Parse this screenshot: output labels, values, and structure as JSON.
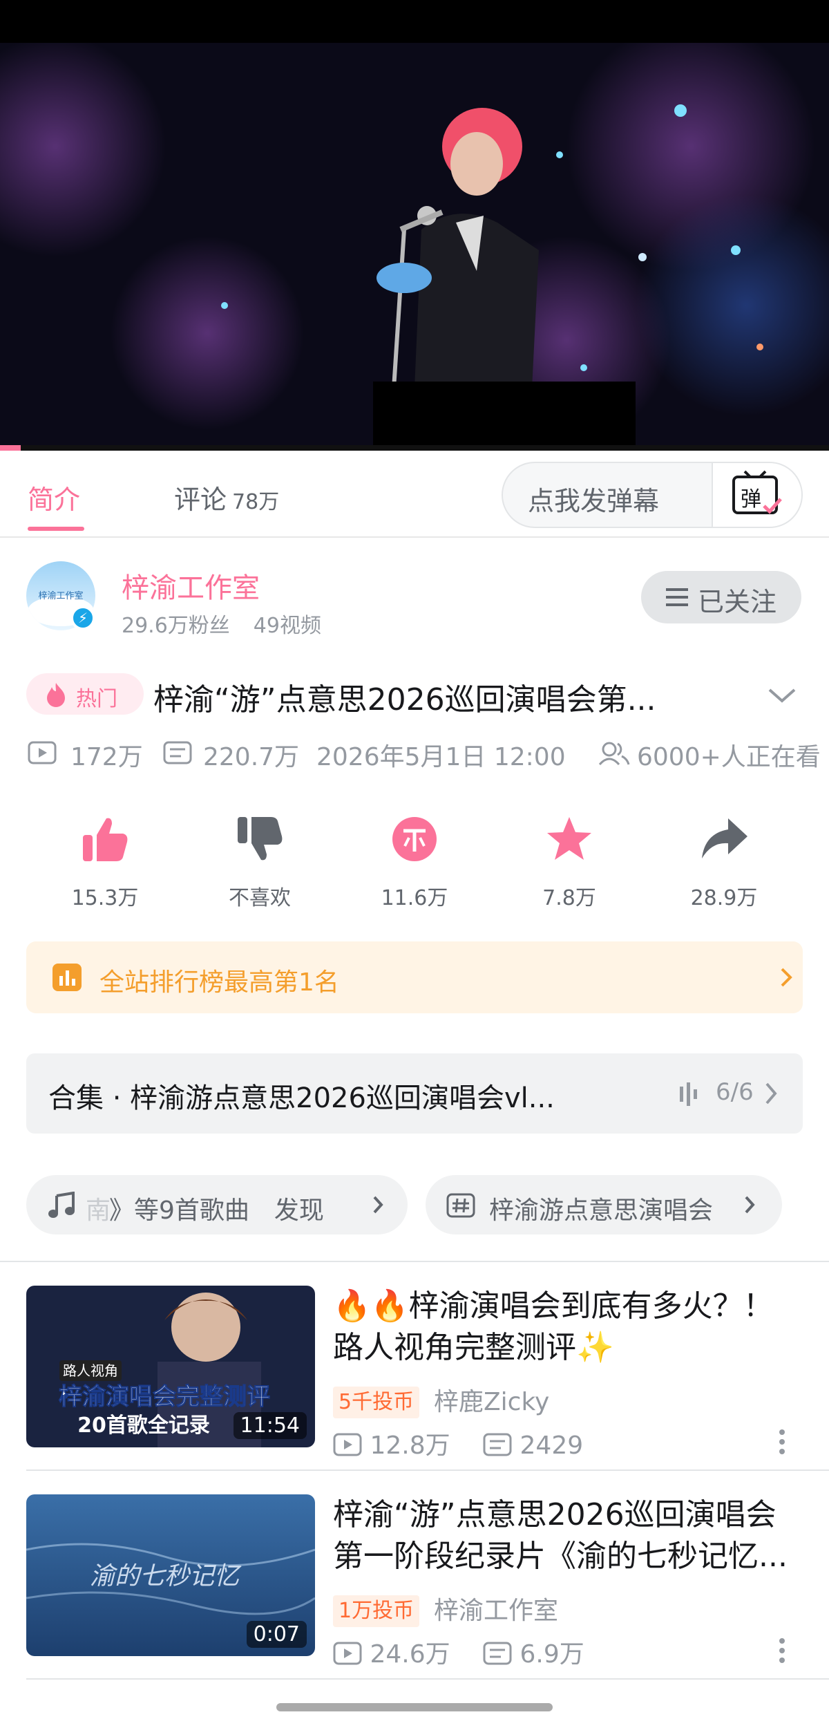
{
  "player": {
    "progress_fraction": 0.025
  },
  "tabs": {
    "intro": "简介",
    "comments": "评论",
    "comments_count": "78万"
  },
  "danmaku": {
    "placeholder": "点我发弹幕",
    "toggle_glyph": "弹"
  },
  "author": {
    "name": "梓渝工作室",
    "avatar_text": "梓渝工作室",
    "fans": "29.6万粉丝",
    "videos": "49视频",
    "follow_label": "已关注"
  },
  "video": {
    "hot_badge": "热门",
    "title": "梓渝“游”点意思2026巡回演唱会第...",
    "views": "172万",
    "danmaku_count": "220.7万",
    "publish_time": "2026年5月1日 12:00",
    "watching": "6000+人正在看"
  },
  "actions": [
    {
      "name": "like",
      "label": "15.3万"
    },
    {
      "name": "dislike",
      "label": "不喜欢"
    },
    {
      "name": "coin",
      "label": "11.6万"
    },
    {
      "name": "favorite",
      "label": "7.8万"
    },
    {
      "name": "share",
      "label": "28.9万"
    }
  ],
  "rank": {
    "text": "全站排行榜最高第1名"
  },
  "collection": {
    "title": "合集 · 梓渝游点意思2026巡回演唱会vl...",
    "progress": "6/6"
  },
  "chips": {
    "music": "》等9首歌曲　发现",
    "music_prefix": "南",
    "topic": "梓渝游点意思演唱会"
  },
  "related": [
    {
      "title": "🔥🔥梓渝演唱会到底有多火？！路人视角完整测评✨",
      "coin_badge": "5千投币",
      "uploader": "梓鹿Zicky",
      "views": "12.8万",
      "danmaku": "2429",
      "duration": "11:54",
      "thumb_line1": "路人视角",
      "thumb_line2": "梓渝演唱会完整测评",
      "thumb_line3": "20首歌全记录"
    },
    {
      "title": "梓渝“游”点意思2026巡回演唱会第一阶段纪录片《渝的七秒记忆...",
      "coin_badge": "1万投币",
      "uploader": "梓渝工作室",
      "views": "24.6万",
      "danmaku": "6.9万",
      "duration": "0:07",
      "thumb_text": "渝的七秒记忆"
    }
  ],
  "colors": {
    "accent": "#fb7299",
    "rank_orange": "#f49e2c",
    "coin_orange": "#ff6a33",
    "muted": "#9499a0",
    "like_pink": "#fb7299",
    "dislike_gray": "#61666d"
  }
}
